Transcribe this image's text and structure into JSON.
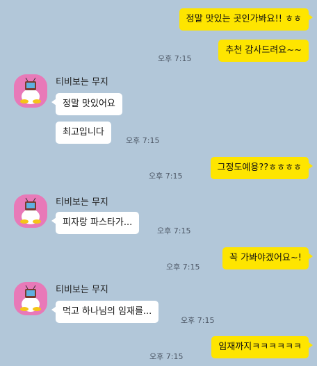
{
  "sender_name": "티비보는 무지",
  "avatar_icon": "muzi-watching-tv-avatar-icon",
  "colors": {
    "background": "#b2c7d9",
    "my_bubble": "#fee500",
    "their_bubble": "#ffffff",
    "avatar_bg": "#e879b8"
  },
  "messages": {
    "m1": {
      "text": "정말 맛있는 곳인가봐요!! ㅎㅎ"
    },
    "m2": {
      "text": "추천 감사드려요~~",
      "time": "오후 7:15"
    },
    "m3": {
      "text": "정말 맛있어요"
    },
    "m4": {
      "text": "최고입니다",
      "time": "오후 7:15"
    },
    "m5": {
      "text": "그정도예용??ㅎㅎㅎㅎ",
      "time": "오후 7:15"
    },
    "m6": {
      "text": "피자랑 파스타가...",
      "time": "오후 7:15"
    },
    "m7": {
      "text": "꼭 가봐야겠어요~!",
      "time": "오후 7:15"
    },
    "m8": {
      "text": "먹고 하나님의 임재를...",
      "time": "오후 7:15"
    },
    "m9": {
      "text": "임재까지ㅋㅋㅋㅋㅋㅋ",
      "time": "오후 7:15"
    }
  }
}
